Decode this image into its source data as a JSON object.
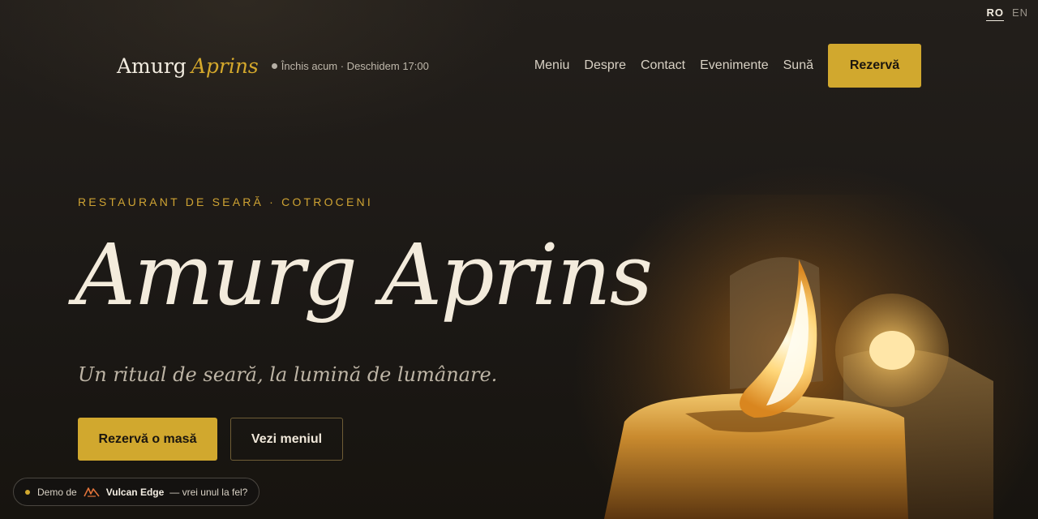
{
  "language_switch": {
    "items": [
      "RO",
      "EN"
    ],
    "active": "RO"
  },
  "header": {
    "brand_first": "Amurg",
    "brand_second": "Aprins",
    "status": "Închis acum · Deschidem 17:00",
    "nav": [
      "Meniu",
      "Despre",
      "Contact",
      "Evenimente",
      "Sună"
    ],
    "cta": "Rezervă"
  },
  "hero": {
    "eyebrow": "RESTAURANT DE SEARĂ · COTROCENI",
    "title": "Amurg Aprins",
    "tagline": "Un ritual de seară, la lumină de lumânare.",
    "primary_button": "Rezervă o masă",
    "secondary_button": "Vezi meniul"
  },
  "demo_badge": {
    "prefix": "Demo de",
    "brand": "Vulcan Edge",
    "suffix": "— vrei unul la fel?"
  },
  "colors": {
    "accent": "#d1a82e",
    "background": "#1a1714",
    "text": "#efe6d6"
  }
}
